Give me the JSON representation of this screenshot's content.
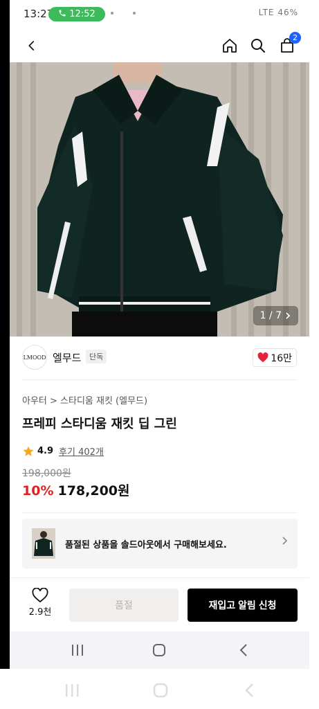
{
  "status_bar": {
    "time": "13:27",
    "call_time": "12:52",
    "right_text": "LTE 46%"
  },
  "header": {
    "cart_count": "2"
  },
  "gallery": {
    "counter": "1 / 7"
  },
  "brand": {
    "logo_text": "LMOOD",
    "name": "엘무드",
    "badge": "단독",
    "likes": "16만"
  },
  "product": {
    "breadcrumb": "아우터 > 스타디움 재킷 (엘무드)",
    "title": "프레피 스타디움 재킷 딥 그린",
    "rating": "4.9",
    "reviews": "후기 402개",
    "original_price": "198,000원",
    "discount": "10%",
    "price": "178,200원"
  },
  "banner": {
    "text": "품절된 상품을 솔드아웃에서 구매해보세요."
  },
  "action_bar": {
    "wish_count": "2.9천",
    "soldout_label": "품절",
    "restock_label": "재입고 알림 신청"
  },
  "colors": {
    "discount": "#e02020",
    "cart_badge": "#1e62ff",
    "call_pill": "#3dbb5c",
    "primary_button": "#000000"
  }
}
